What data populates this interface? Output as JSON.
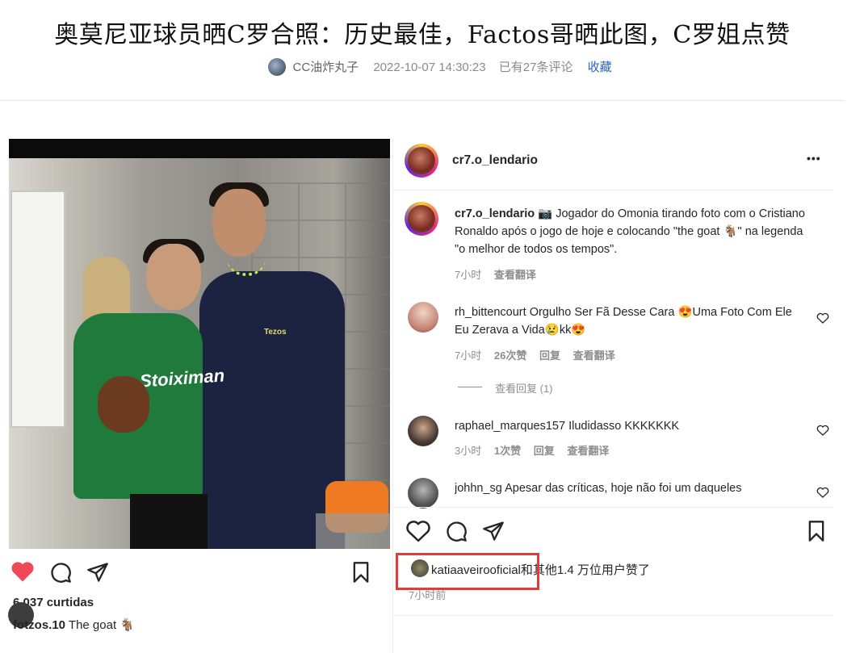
{
  "article": {
    "title": "奥莫尼亚球员晒C罗合照：历史最佳，Factos哥晒此图，C罗姐点赞",
    "author": "CC油炸丸子",
    "datetime": "2022-10-07 14:30:23",
    "comments_count": "已有27条评论",
    "favorite_label": "收藏"
  },
  "left_post": {
    "likes": "6.037 curtidas",
    "caption_user": "fotzos.10",
    "caption_text": "The goat 🐐",
    "shirt_sponsor": "Stoiximan",
    "shirt_sponsor_2": "Tezos"
  },
  "right_post": {
    "account": "cr7.o_lendario",
    "more": "•••",
    "caption_handle": "cr7.o_lendario",
    "caption_text": "📷 Jogador do Omonia tirando foto com o Cristiano Ronaldo após o jogo de hoje e colocando \"the goat 🐐\" na legenda \"o melhor de todos os tempos\".",
    "caption_time": "7小时",
    "caption_translate": "查看翻译",
    "comments": [
      {
        "user": "rh_bittencourt",
        "text": "Orgulho Ser Fã Desse Cara 😍Uma Foto Com Ele Eu Zerava a Vida😢kk😍",
        "time": "7小时",
        "likes": "26次赞",
        "reply": "回复",
        "translate": "查看翻译",
        "view_replies": "查看回复 (1)"
      },
      {
        "user": "raphael_marques157",
        "text": "Iludidasso KKKKKKK",
        "time": "3小时",
        "likes": "1次赞",
        "reply": "回复",
        "translate": "查看翻译"
      },
      {
        "user": "johhn_sg",
        "text": "Apesar das críticas, hoje não foi um daqueles"
      }
    ],
    "liked_by_user": "katiaaveirooficial",
    "liked_by_rest": "和其他1.4 万位用户赞了",
    "time_ago": "7小时前"
  },
  "colors": {
    "heart_red": "#ed4956",
    "link_blue": "#2b63c9",
    "highlight_red": "#e23b3b"
  }
}
